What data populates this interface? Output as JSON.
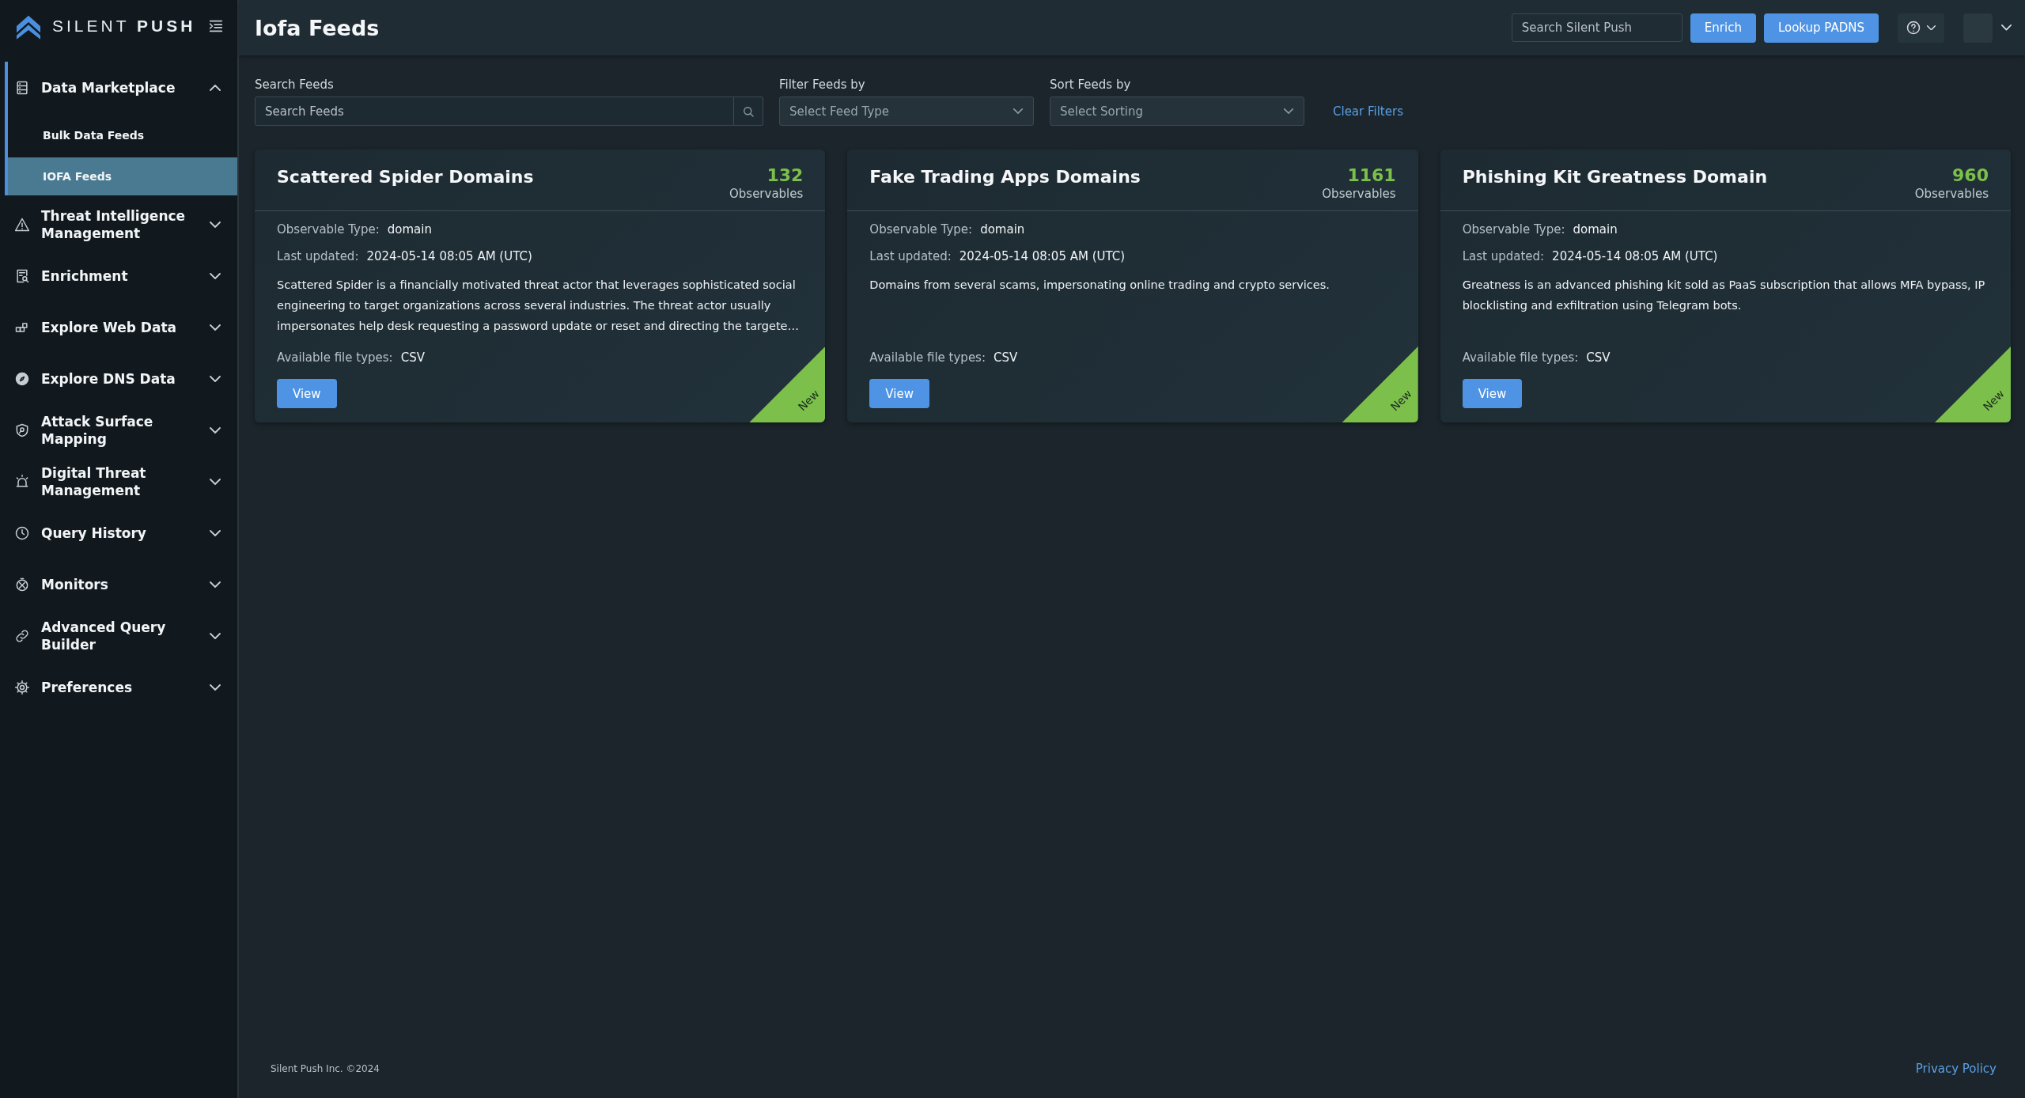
{
  "brand": {
    "name": "SILENT **PUSH**"
  },
  "sidebar": {
    "items": [
      {
        "label": "Data Marketplace",
        "expanded": true,
        "children": [
          {
            "label": "Bulk Data Feeds",
            "selected": false
          },
          {
            "label": "IOFA Feeds",
            "selected": true
          }
        ]
      },
      {
        "label": "Threat Intelligence Management",
        "expanded": false
      },
      {
        "label": "Enrichment",
        "expanded": false
      },
      {
        "label": "Explore Web Data",
        "expanded": false
      },
      {
        "label": "Explore DNS Data",
        "expanded": false
      },
      {
        "label": "Attack Surface Mapping",
        "expanded": false
      },
      {
        "label": "Digital Threat Management",
        "expanded": false
      },
      {
        "label": "Query History",
        "expanded": false
      },
      {
        "label": "Monitors",
        "expanded": false
      },
      {
        "label": "Advanced Query Builder",
        "expanded": false
      },
      {
        "label": "Preferences",
        "expanded": false
      }
    ]
  },
  "header": {
    "title": "Iofa Feeds",
    "search": {
      "placeholder": "Search Silent Push"
    },
    "buttons": [
      "Enrich",
      "Lookup PADNS"
    ]
  },
  "filters": {
    "search": {
      "label": "Search Feeds",
      "placeholder": "Search Feeds"
    },
    "filter": {
      "label": "Filter Feeds by",
      "placeholder": "Select Feed Type"
    },
    "sort": {
      "label": "Sort Feeds by",
      "placeholder": "Select Sorting"
    },
    "clear": "Clear Filters"
  },
  "cards": [
    {
      "title": "Scattered Spider Domains",
      "count": "132",
      "count_label": "Observables",
      "details": [
        {
          "label": "Observable Type:",
          "value": "domain"
        },
        {
          "label": "Last updated:",
          "value": "2024-05-14 08:05 AM (UTC)"
        }
      ],
      "description": "Scattered Spider is a financially motivated threat actor that leverages sophisticated social engineering to target organizations across several industries. The threat actor usually impersonates help desk requesting a password update or reset and directing the targete…",
      "file_types": {
        "label": "Available file types:",
        "value": "CSV"
      },
      "button": "View",
      "badge": "New"
    },
    {
      "title": "Fake Trading Apps Domains",
      "count": "1161",
      "count_label": "Observables",
      "details": [
        {
          "label": "Observable Type:",
          "value": "domain"
        },
        {
          "label": "Last updated:",
          "value": "2024-05-14 08:05 AM (UTC)"
        }
      ],
      "description": "Domains from several scams, impersonating online trading and crypto services.",
      "file_types": {
        "label": "Available file types:",
        "value": "CSV"
      },
      "button": "View",
      "badge": "New"
    },
    {
      "title": "Phishing Kit Greatness Domain",
      "count": "960",
      "count_label": "Observables",
      "details": [
        {
          "label": "Observable Type:",
          "value": "domain"
        },
        {
          "label": "Last updated:",
          "value": "2024-05-14 08:05 AM (UTC)"
        }
      ],
      "description": "Greatness is an advanced phishing kit sold as PaaS subscription that allows MFA bypass, IP blocklisting and exfiltration using Telegram bots.",
      "file_types": {
        "label": "Available file types:",
        "value": "CSV"
      },
      "button": "View",
      "badge": "New"
    }
  ],
  "footer": {
    "copyright": "Silent Push Inc. ©2024",
    "privacy": "Privacy Policy"
  }
}
